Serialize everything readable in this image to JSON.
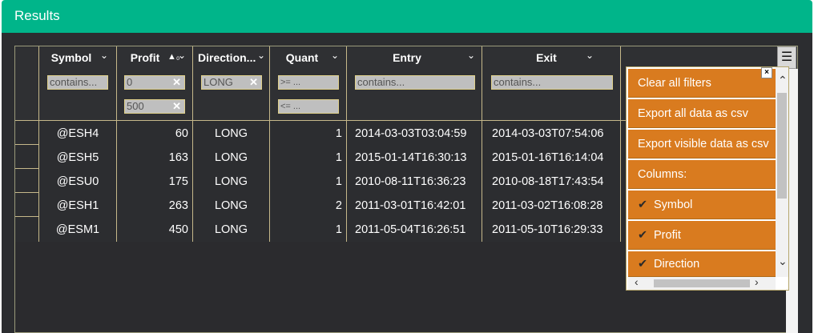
{
  "panel": {
    "title": "Results"
  },
  "columns": [
    {
      "label": "Symbol"
    },
    {
      "label": "Profit",
      "sort_indicator": "▲₀"
    },
    {
      "label": "Direction..."
    },
    {
      "label": "Quant"
    },
    {
      "label": "Entry"
    },
    {
      "label": "Exit"
    }
  ],
  "filters": {
    "symbol": "contains...",
    "profit_min": "0",
    "profit_max": "500",
    "direction": "LONG",
    "quant_min": ">= ...",
    "quant_max": "<= ...",
    "entry": "contains...",
    "exit": "contains..."
  },
  "rows": [
    {
      "symbol": "@ESH4",
      "profit": "60",
      "direction": "LONG",
      "quant": "1",
      "entry": "2014-03-03T03:04:59",
      "exit": "2014-03-03T07:54:06"
    },
    {
      "symbol": "@ESH5",
      "profit": "163",
      "direction": "LONG",
      "quant": "1",
      "entry": "2015-01-14T16:30:13",
      "exit": "2015-01-16T16:14:04"
    },
    {
      "symbol": "@ESU0",
      "profit": "175",
      "direction": "LONG",
      "quant": "1",
      "entry": "2010-08-11T16:36:23",
      "exit": "2010-08-18T17:43:54"
    },
    {
      "symbol": "@ESH1",
      "profit": "263",
      "direction": "LONG",
      "quant": "2",
      "entry": "2011-03-01T16:42:01",
      "exit": "2011-03-02T16:08:28"
    },
    {
      "symbol": "@ESM1",
      "profit": "450",
      "direction": "LONG",
      "quant": "1",
      "entry": "2011-05-04T16:26:51",
      "exit": "2011-05-10T16:29:33"
    }
  ],
  "menu": {
    "items": [
      {
        "label": "Clear all filters"
      },
      {
        "label": "Export all data as csv"
      },
      {
        "label": "Export visible data as csv"
      },
      {
        "label": "Columns:"
      },
      {
        "label": "Symbol",
        "checked": true
      },
      {
        "label": "Profit",
        "checked": true
      },
      {
        "label": "Direction",
        "checked": true
      }
    ],
    "close": "×"
  },
  "icons": {
    "chevron": "chevron-down-icon",
    "menu": "hamburger-icon",
    "clear": "clear-x-icon",
    "check": "check-icon"
  },
  "colors": {
    "header_green": "#00b58a",
    "grid_bg": "#2c2d30",
    "menu_orange": "#d97b1f",
    "filter_bg": "#bfbfbf"
  }
}
